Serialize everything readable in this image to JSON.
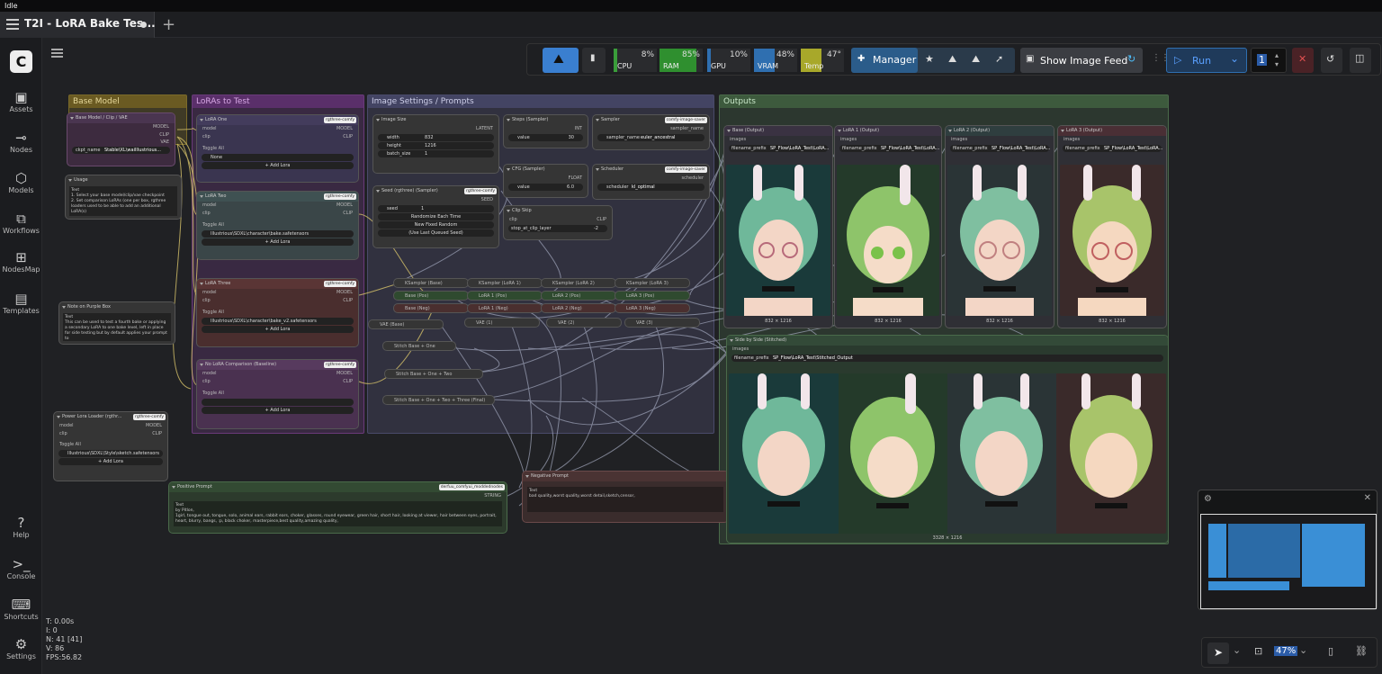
{
  "status": "Idle",
  "tab": {
    "title": "T2I - LoRA Bake Tes...",
    "new_tab": "+"
  },
  "sidebar": {
    "items": [
      {
        "label": "Assets",
        "icon": "image-icon"
      },
      {
        "label": "Nodes",
        "icon": "nodes-icon"
      },
      {
        "label": "Models",
        "icon": "cube-icon"
      },
      {
        "label": "Workflows",
        "icon": "workflow-icon"
      },
      {
        "label": "NodesMap",
        "icon": "sitemap-icon"
      },
      {
        "label": "Templates",
        "icon": "template-icon"
      },
      {
        "label": "Help",
        "icon": "help-icon"
      },
      {
        "label": "Console",
        "icon": "terminal-icon"
      },
      {
        "label": "Shortcuts",
        "icon": "keyboard-icon"
      },
      {
        "label": "Settings",
        "icon": "gear-icon"
      }
    ]
  },
  "toolbar": {
    "meters": [
      {
        "label": "CPU",
        "value": "8%",
        "color": "#3a9d3a"
      },
      {
        "label": "RAM",
        "value": "85%",
        "color": "#2f8f2f"
      },
      {
        "label": "GPU",
        "value": "10%",
        "color": "#2f6fb0"
      },
      {
        "label": "VRAM",
        "value": "48%",
        "color": "#2f6fb0"
      },
      {
        "label": "Temp",
        "value": "47°",
        "color": "#a8a82a"
      }
    ],
    "manager": "Manager",
    "show_image_feed": "Show Image Feed",
    "run": "Run",
    "batch_count": "1"
  },
  "groups": [
    {
      "title": "Base Model",
      "color": "#7a6a2a"
    },
    {
      "title": "LoRAs to Test",
      "color": "#6a3a7a"
    },
    {
      "title": "Image Settings / Prompts",
      "color": "#4a4a6a"
    },
    {
      "title": "Outputs",
      "color": "#4a6a4a"
    }
  ],
  "nodes": {
    "base_model": {
      "title": "Base Model / Clip / VAE",
      "out": [
        "MODEL",
        "CLIP",
        "VAE"
      ],
      "widget_label": "ckpt_name",
      "widget_value": "Stable\\XL\\waiIllustrious..."
    },
    "usage": {
      "title": "Usage",
      "label": "Text",
      "text": "1. Select your base model/clip/vae checkpoint\n2. Set comparison LoRAs (one per box, rgthree loaders used to be able to add an additional LoRA(s)"
    },
    "note_purple": {
      "title": "Note on Purple Box",
      "label": "Text",
      "text": "This can be used to test a fourth bake or applying a secondary LoRA to one bake level, left in place for side testing but by default applies your prompt to"
    },
    "lora_one": {
      "title": "LoRA One",
      "badge": "rgthree-comfy",
      "in": [
        "model",
        "clip"
      ],
      "out": [
        "MODEL",
        "CLIP"
      ],
      "lora": "Toggle All",
      "lora2": "None",
      "add": "+ Add Lora"
    },
    "lora_two": {
      "title": "LoRA Two",
      "badge": "rgthree-comfy",
      "in": [
        "model",
        "clip"
      ],
      "out": [
        "MODEL",
        "CLIP"
      ],
      "lora": "Toggle All",
      "lora2": "Illustrious\\SDXL\\character\\bake.safetensors",
      "add": "+ Add Lora"
    },
    "lora_three": {
      "title": "LoRA Three",
      "badge": "rgthree-comfy",
      "in": [
        "model",
        "clip"
      ],
      "out": [
        "MODEL",
        "CLIP"
      ],
      "lora": "Toggle All",
      "lora2": "Illustrious\\SDXL\\character\\bake_v2.safetensors",
      "add": "+ Add Lora"
    },
    "no_lora": {
      "title": "No LoRA Comparison (Baseline)",
      "badge": "rgthree-comfy",
      "in": [
        "model",
        "clip"
      ],
      "out": [
        "MODEL",
        "CLIP"
      ],
      "lora": "Toggle All",
      "add": "+ Add Lora"
    },
    "power_lora": {
      "title": "Power Lora Loader (rgthr...",
      "badge": "rgthree-comfy",
      "in": [
        "model",
        "clip"
      ],
      "out": [
        "MODEL",
        "CLIP"
      ],
      "lora": "Toggle All",
      "lora2": "Illustrious\\SDXL\\Style\\sketch.safetensors",
      "add": "+ Add Lora"
    },
    "image_size": {
      "title": "Image Size",
      "out": "LATENT",
      "width_label": "width",
      "width": "832",
      "height_label": "height",
      "height": "1216",
      "batch_label": "batch_size",
      "batch": "1"
    },
    "steps": {
      "title": "Steps (Sampler)",
      "out": "INT",
      "label": "value",
      "value": "30"
    },
    "cfg": {
      "title": "CFG (Sampler)",
      "out": "FLOAT",
      "label": "value",
      "value": "6.0"
    },
    "sampler": {
      "title": "Sampler",
      "badge": "comfy-image-saver",
      "out": "sampler_name",
      "label": "sampler_name",
      "value": "euler_ancestral"
    },
    "scheduler": {
      "title": "Scheduler",
      "badge": "comfy-image-saver",
      "out": "scheduler",
      "label": "scheduler",
      "value": "kl_optimal"
    },
    "seed": {
      "title": "Seed (rgthree) (Sampler)",
      "badge": "rgthree-comfy",
      "out": "SEED",
      "label": "seed",
      "value": "1",
      "btn1": "Randomize Each Time",
      "btn2": "New Fixed Random",
      "btn3": "(Use Last Queued Seed)"
    },
    "clip_skip": {
      "title": "Clip Skip",
      "in": "clip",
      "out": "CLIP",
      "label": "stop_at_clip_layer",
      "value": "-2"
    },
    "positive": {
      "title": "Positive Prompt",
      "badge": "derfuu_comfyui_moddednodes",
      "out": "STRING",
      "label": "Text",
      "text": "by Pitlon,\n1girl, tongue out, tongue, solo, animal ears, rabbit ears, choker, glasses, round eyewear, green hair, short hair, looking at viewer, hair between eyes, portrait, heart, blurry, bangs, :p, black choker, masterpiece,best quality,amazing quality,"
    },
    "negative": {
      "title": "Negative Prompt",
      "label": "Text",
      "text": "bad quality,worst quality,worst detail,sketch,censor,"
    }
  },
  "reroutes": [
    "KSampler (Base)",
    "KSampler (LoRA 1)",
    "KSampler (LoRA 2)",
    "KSampler (LoRA 3)",
    "Base (Pos)",
    "LoRA 1 (Pos)",
    "LoRA 2 (Pos)",
    "LoRA 3 (Pos)",
    "Base (Neg)",
    "LoRA 1 (Neg)",
    "LoRA 2 (Neg)",
    "LoRA 3 (Neg)",
    "VAE (Base)",
    "VAE (1)",
    "VAE (2)",
    "VAE (3)",
    "Stitch Base + One",
    "Stitch Base + One + Two",
    "Stitch Base + One + Two + Three (Final)"
  ],
  "outputs": [
    {
      "title": "Base (Output)",
      "prefix_label": "filename_prefix",
      "prefix": "SP_Flow\\LoRA_Test\\LoRA...",
      "images_label": "images",
      "size": "832 × 1216"
    },
    {
      "title": "LoRA 1 (Output)",
      "prefix_label": "filename_prefix",
      "prefix": "SP_Flow\\LoRA_Test\\LoRA...",
      "images_label": "images",
      "size": "832 × 1216"
    },
    {
      "title": "LoRA 2 (Output)",
      "prefix_label": "filename_prefix",
      "prefix": "SP_Flow\\LoRA_Test\\LoRA...",
      "images_label": "images",
      "size": "832 × 1216"
    },
    {
      "title": "LoRA 3 (Output)",
      "prefix_label": "filename_prefix",
      "prefix": "SP_Flow\\LoRA_Test\\LoRA...",
      "images_label": "images",
      "size": "832 × 1216"
    }
  ],
  "stitched": {
    "title": "Side by Side (Stitched)",
    "images_label": "images",
    "prefix_label": "filename_prefix",
    "prefix": "SP_Flow\\LoRA_Test\\Stitched_Output",
    "size": "3328 × 1216"
  },
  "stats": {
    "t": "T: 0.00s",
    "i": "I: 0",
    "n": "N: 41 [41]",
    "v": "V: 86",
    "fps": "FPS:56.82"
  },
  "zoom": "47%"
}
